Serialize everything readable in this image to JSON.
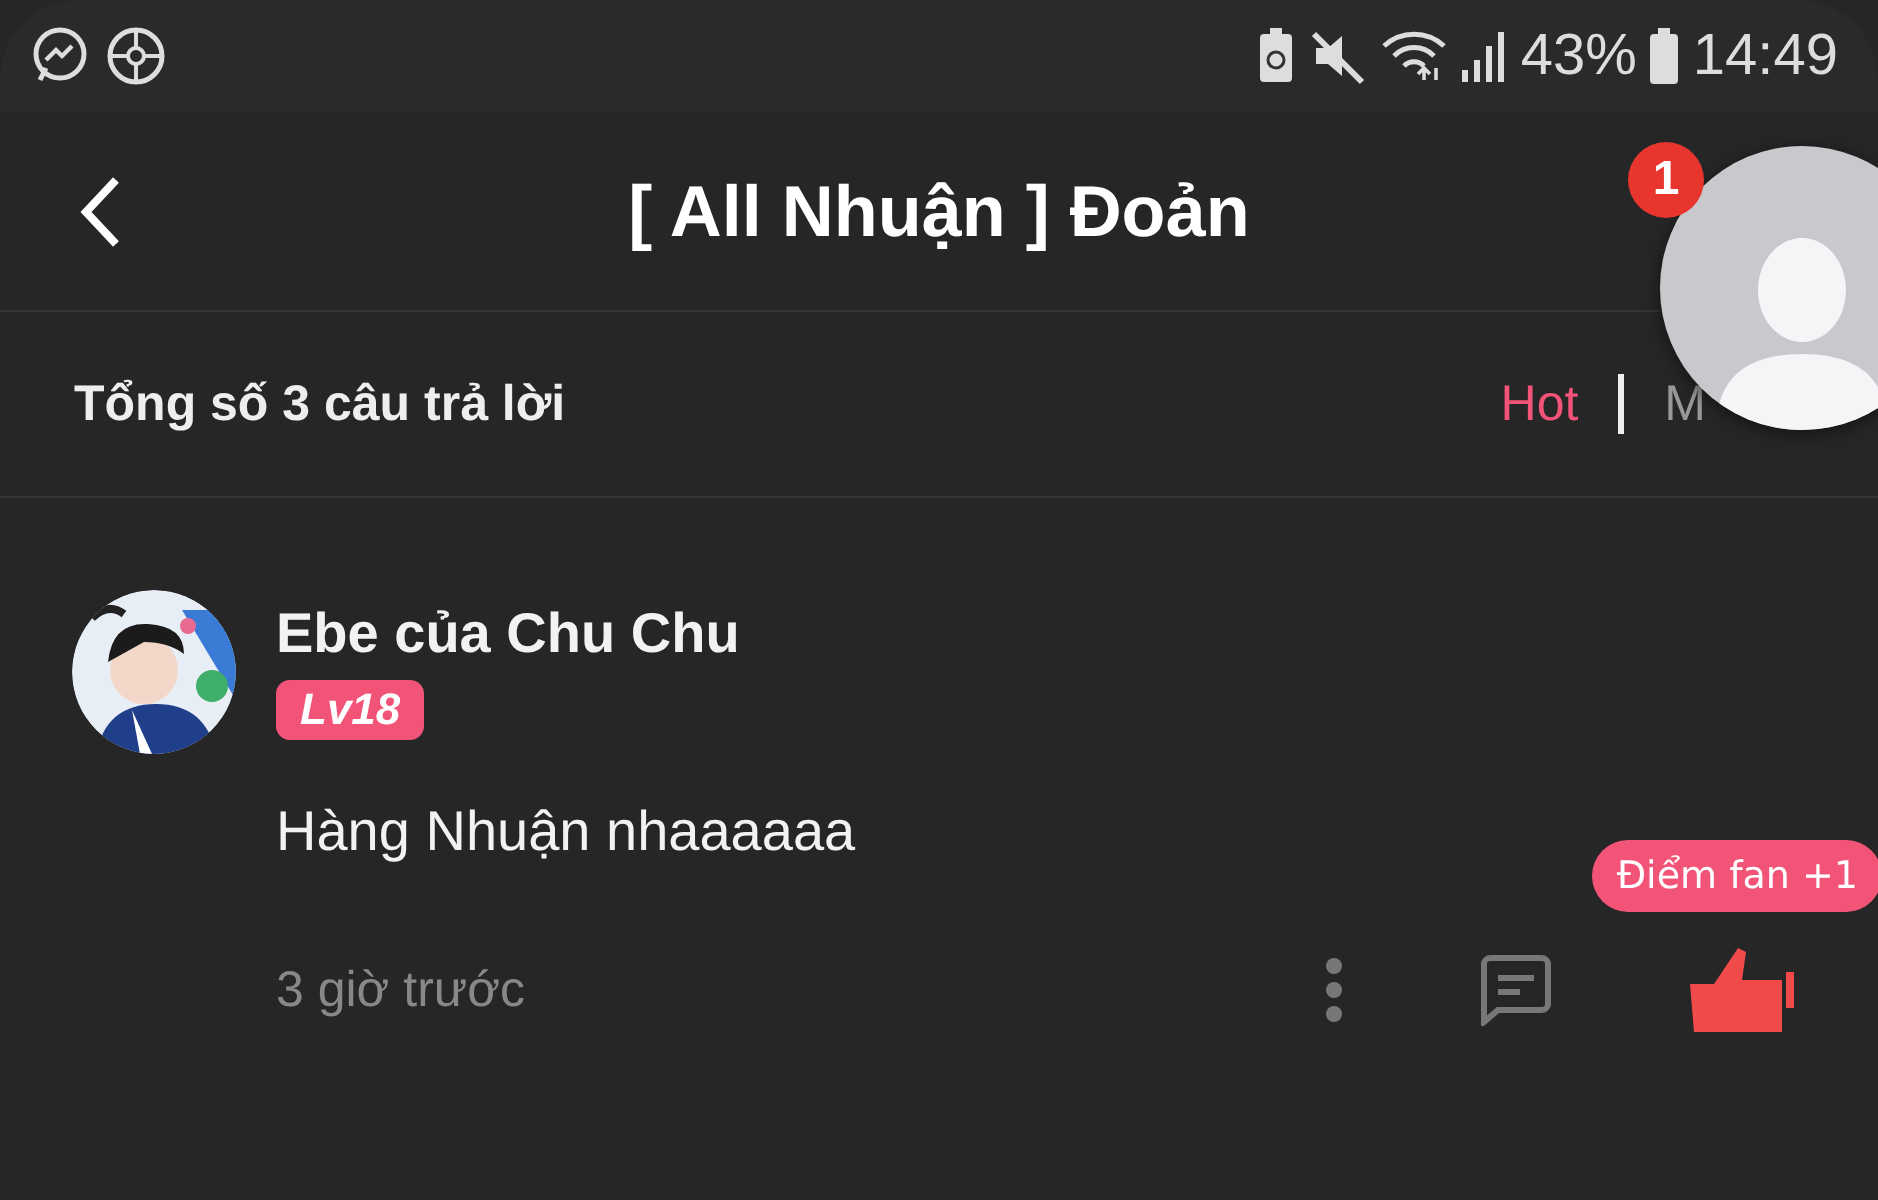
{
  "status_bar": {
    "battery_percent": "43%",
    "time": "14:49"
  },
  "header": {
    "title": "[ All Nhuận ] Đoản"
  },
  "summary": {
    "count_text": "Tổng số 3 câu trả lời",
    "sort_tabs": [
      {
        "label": "Hot",
        "selected": true
      },
      {
        "label": "M",
        "selected": false
      }
    ]
  },
  "floating_bubble": {
    "badge": "1"
  },
  "comments": [
    {
      "author": "Ebe của Chu Chu",
      "level_badge": "Lv18",
      "text": "Hàng Nhuận nhaaaaaa",
      "time": "3 giờ trước",
      "points_tooltip": "Điểm fan +1",
      "liked": true
    }
  ]
}
